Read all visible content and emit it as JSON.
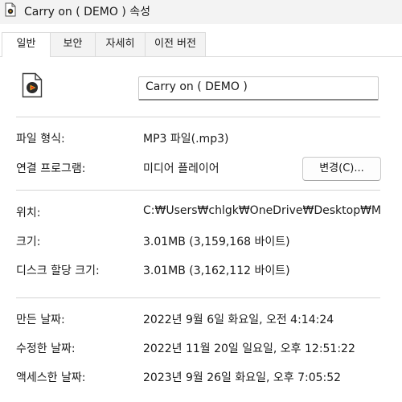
{
  "window": {
    "title": "Carry on ( DEMO ) 속성"
  },
  "tabs": [
    {
      "label": "일반",
      "active": true
    },
    {
      "label": "보안",
      "active": false
    },
    {
      "label": "자세히",
      "active": false
    },
    {
      "label": "이전 버전",
      "active": false
    }
  ],
  "file": {
    "name": "Carry on ( DEMO )",
    "icon": "media-file-icon"
  },
  "rows": {
    "file_type": {
      "label": "파일 형식:",
      "value": "MP3 파일(.mp3)"
    },
    "opens_with": {
      "label": "연결 프로그램:",
      "value": "미디어 플레이어",
      "button": "변경(C)..."
    },
    "location": {
      "label": "위치:",
      "value": "C:₩Users₩chlgk₩OneDrive₩Desktop₩Music₩"
    },
    "size": {
      "label": "크기:",
      "value": "3.01MB (3,159,168 바이트)"
    },
    "size_on_disk": {
      "label": "디스크 할당 크기:",
      "value": "3.01MB (3,162,112 바이트)"
    },
    "created": {
      "label": "만든 날짜:",
      "value": "2022년 9월 6일 화요일, 오전 4:14:24"
    },
    "modified": {
      "label": "수정한 날짜:",
      "value": "2022년 11월 20일 일요일, 오후 12:51:22"
    },
    "accessed": {
      "label": "액세스한 날짜:",
      "value": "2023년 9월 26일 화요일, 오후 7:05:52"
    }
  },
  "colors": {
    "accent": "#e81e1e",
    "icon_dark": "#2b2b2b"
  }
}
